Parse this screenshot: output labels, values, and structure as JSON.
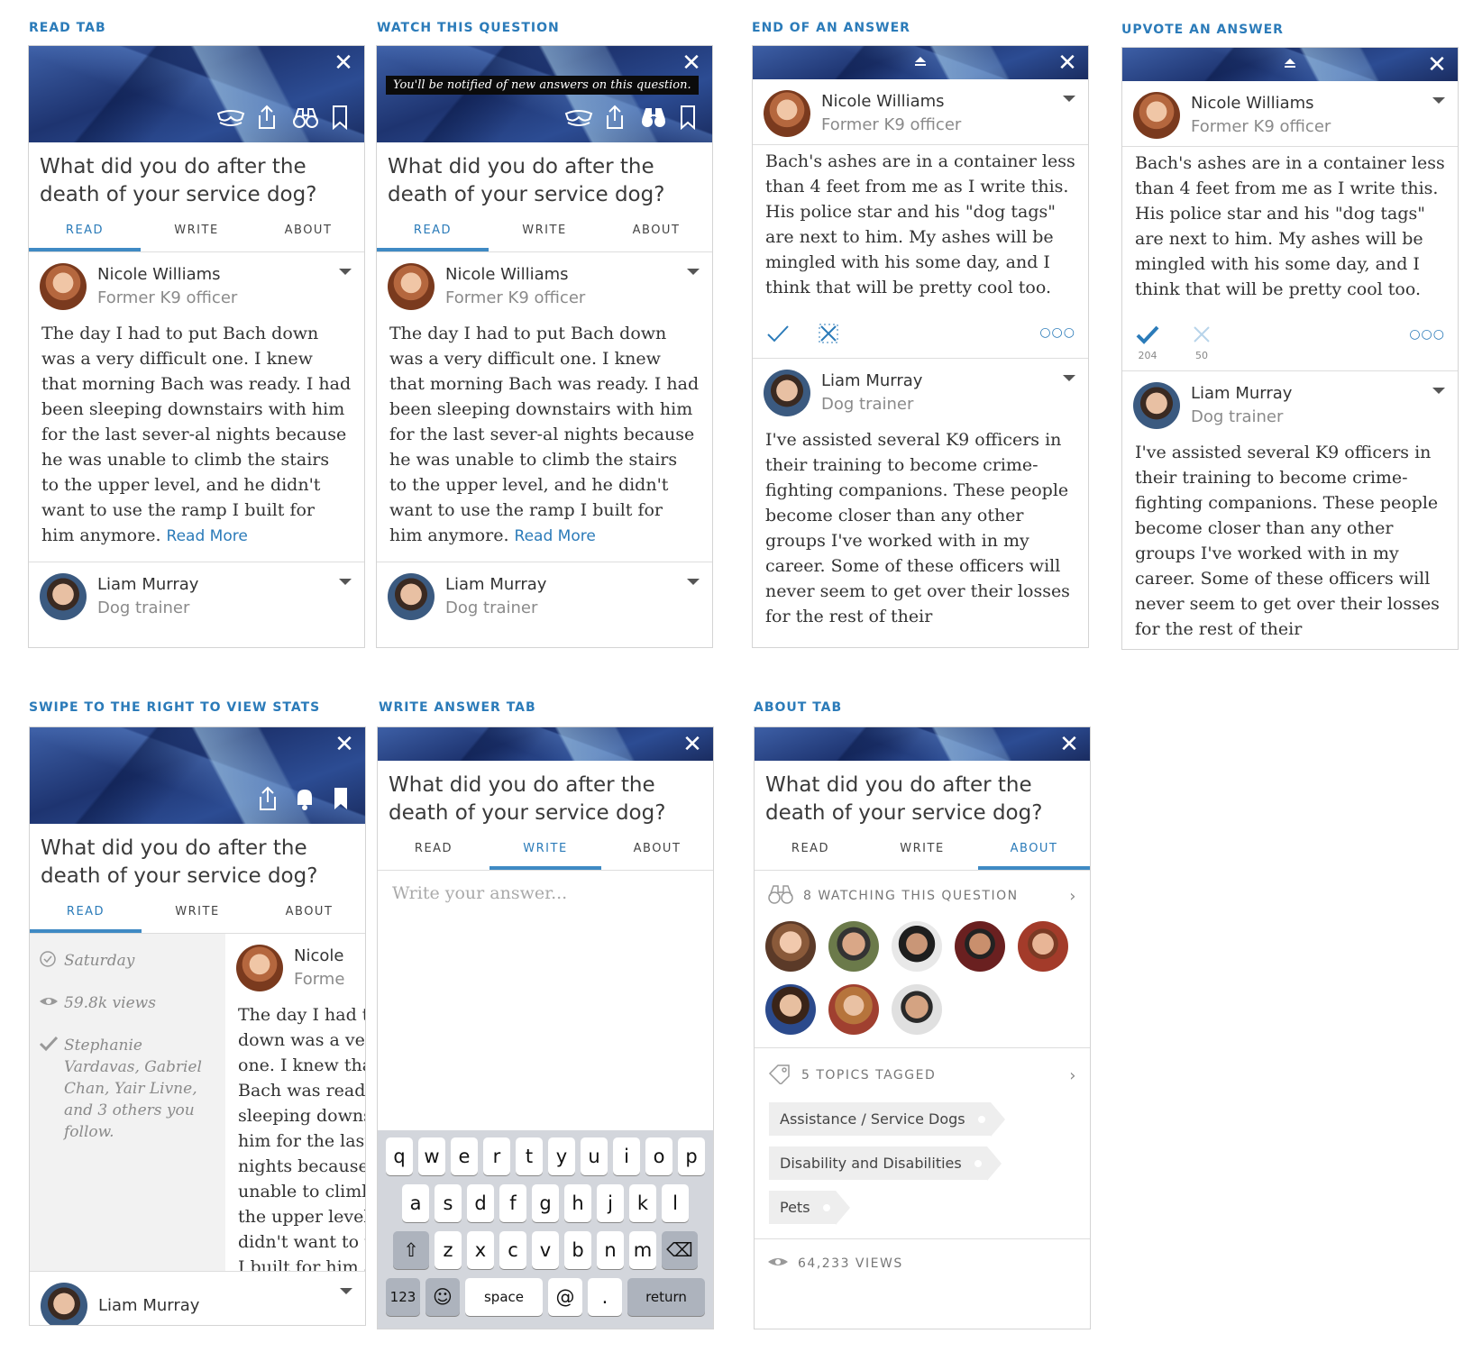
{
  "captions": {
    "read_tab": "READ TAB",
    "watch": "WATCH THIS QUESTION",
    "end_answer": "END OF AN ANSWER",
    "upvote": "UPVOTE AN ANSWER",
    "swipe": "SWIPE TO THE RIGHT TO VIEW STATS",
    "write_tab": "WRITE ANSWER TAB",
    "about_tab": "ABOUT TAB"
  },
  "question": {
    "title": "What did you do after the death of your service dog?"
  },
  "tabs": {
    "read": "READ",
    "write": "WRITE",
    "about": "ABOUT"
  },
  "close_glyph": "✕",
  "tooltip": "You'll be notified of new answers on this question.",
  "answer1": {
    "name": "Nicole Williams",
    "cred": "Former K9 officer",
    "body": "The day I had to put Bach down was a very difficult one. I knew that morning Bach was ready. I had been sleeping downstairs with him for the last sever-al nights because he was unable to climb the stairs to the upper level, and he didn't want to use the ramp I built for him anymore.",
    "read_more": "Read More",
    "end_text": "Bach's ashes are in a container less than 4 feet from me as I write this. His police star and his \"dog tags\" are next to him. My ashes will be mingled with his some day, and I think that will be pretty cool too.",
    "upvotes": "204",
    "downvotes": "50",
    "swipe_name": "Nicole",
    "swipe_cred": "Forme",
    "swipe_body": "The day I had to put Bach down was a very difficult one. I knew that morning Bach was ready. I had been sleeping downstairs with him for the last several nights because he was unable to climb the stairs to the upper level, and he didn't want to use the ramp I built for him anymore."
  },
  "answer2": {
    "name": "Liam Murray",
    "cred": "Dog trainer",
    "body": "I've assisted several K9 officers in their training to become crime-fighting companions. These people become closer than any other groups I've worked with in my career. Some of these officers will never seem to get over their losses for the rest of their"
  },
  "stats": {
    "date": "Saturday",
    "views": "59.8k views",
    "followers": "Stephanie Vardavas, Gabriel Chan, Yair Livne, and 3 others you follow."
  },
  "write": {
    "placeholder": "Write your answer...",
    "row1": [
      "q",
      "w",
      "e",
      "r",
      "t",
      "y",
      "u",
      "i",
      "o",
      "p"
    ],
    "row2": [
      "a",
      "s",
      "d",
      "f",
      "g",
      "h",
      "j",
      "k",
      "l"
    ],
    "row3": [
      "z",
      "x",
      "c",
      "v",
      "b",
      "n",
      "m"
    ],
    "key_123": "123",
    "key_emoji": "☺",
    "key_space": "space",
    "key_at": "@",
    "key_dot": ".",
    "key_return": "return"
  },
  "about": {
    "watching": "8 WATCHING THIS QUESTION",
    "topics_tagged": "5 TOPICS TAGGED",
    "topics": [
      "Assistance / Service Dogs",
      "Disability and Disabilities",
      "Pets"
    ],
    "views": "64,233 VIEWS"
  },
  "colors": {
    "accent": "#2b7bb9",
    "banner": "#1e3470"
  }
}
